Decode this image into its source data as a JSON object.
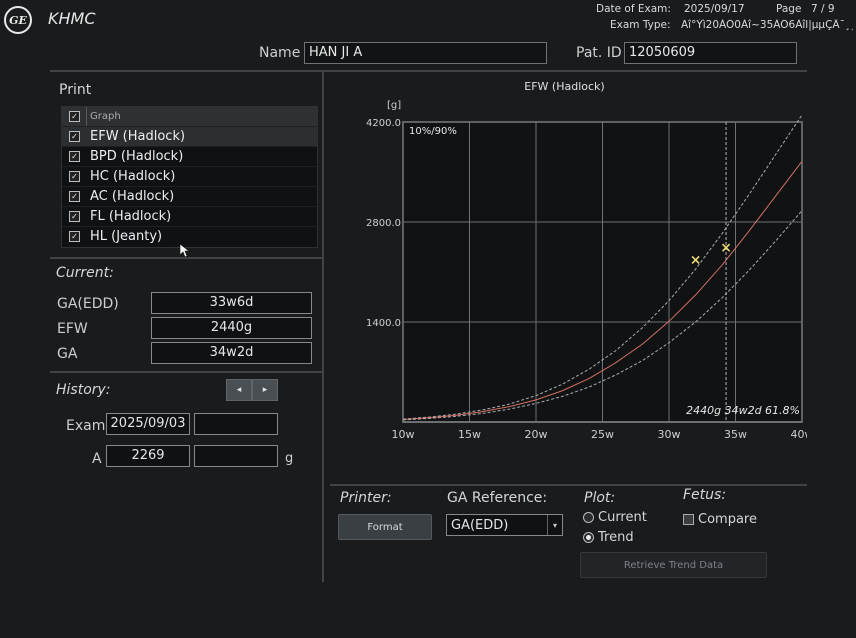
{
  "header": {
    "logo_text": "GE",
    "hospital": "KHMC",
    "date_label": "Date of Exam:",
    "date_value": "2025/09/17",
    "page_label": "Page",
    "page_value": "7 / 9",
    "exam_type_label": "Exam Type:",
    "exam_type_value": "Ãî°Ýì20ÀÖ0Àî~35ÀÖ6Àîl|µµÇÂ¯¸¸",
    "name_label": "Name",
    "name_value": "HAN JI A",
    "patid_label": "Pat. ID",
    "patid_value": "12050609"
  },
  "print": {
    "title": "Print",
    "column_header": "Graph",
    "header_checked": true,
    "items": [
      {
        "label": "EFW (Hadlock)",
        "checked": true,
        "selected": true
      },
      {
        "label": "BPD (Hadlock)",
        "checked": true,
        "selected": false
      },
      {
        "label": "HC (Hadlock)",
        "checked": true,
        "selected": false
      },
      {
        "label": "AC (Hadlock)",
        "checked": true,
        "selected": false
      },
      {
        "label": "FL (Hadlock)",
        "checked": true,
        "selected": false
      },
      {
        "label": "HL (Jeanty)",
        "checked": true,
        "selected": false
      }
    ]
  },
  "current": {
    "title": "Current:",
    "rows": [
      {
        "label": "GA(EDD)",
        "value": "33w6d"
      },
      {
        "label": "EFW",
        "value": "2440g"
      },
      {
        "label": "GA",
        "value": "34w2d"
      }
    ]
  },
  "history": {
    "title": "History:",
    "prev_icon": "chevron-left-icon",
    "next_icon": "chevron-right-icon",
    "exam_label": "Exam",
    "exam_value": "2025/09/03",
    "exam_value2": "",
    "a_label": "A",
    "a_value": "2269",
    "a_value2": "",
    "a_unit": "g"
  },
  "bottom": {
    "printer_label": "Printer:",
    "format_button": "Format",
    "ga_ref_label": "GA Reference:",
    "ga_ref_value": "GA(EDD)",
    "plot_label": "Plot:",
    "plot_options": [
      {
        "label": "Current",
        "selected": false
      },
      {
        "label": "Trend",
        "selected": true
      }
    ],
    "fetus_label": "Fetus:",
    "compare_label": "Compare",
    "compare_checked": false,
    "retrieve_button": "Retrieve Trend Data"
  },
  "chart_data": {
    "type": "line",
    "title": "EFW (Hadlock)",
    "ylabel": "[g]",
    "xlabel": "",
    "band_label": "10%/90%",
    "x_ticks": [
      "10w",
      "15w",
      "20w",
      "25w",
      "30w",
      "35w",
      "40w"
    ],
    "y_ticks": [
      "1400.0",
      "2800.0",
      "4200.0"
    ],
    "xlim": [
      10,
      40
    ],
    "ylim": [
      0,
      4200
    ],
    "grid": true,
    "x": [
      10,
      12,
      14,
      16,
      18,
      20,
      22,
      24,
      26,
      28,
      30,
      32,
      34,
      36,
      38,
      40
    ],
    "series": [
      {
        "role": "p90",
        "color": "#a9adb1",
        "dash": true,
        "values": [
          40,
          70,
          110,
          170,
          250,
          370,
          530,
          740,
          1000,
          1320,
          1700,
          2140,
          2640,
          3180,
          3740,
          4300
        ]
      },
      {
        "role": "median",
        "color": "#d47060",
        "dash": false,
        "values": [
          35,
          60,
          95,
          145,
          215,
          310,
          440,
          610,
          830,
          1090,
          1410,
          1780,
          2200,
          2670,
          3160,
          3650
        ]
      },
      {
        "role": "p10",
        "color": "#a9adb1",
        "dash": true,
        "values": [
          30,
          50,
          80,
          120,
          180,
          260,
          360,
          490,
          660,
          860,
          1110,
          1400,
          1740,
          2120,
          2530,
          2960
        ]
      }
    ],
    "points": [
      {
        "x": 32.0,
        "y": 2269,
        "color": "#f2dc78"
      },
      {
        "x": 34.29,
        "y": 2440,
        "color": "#f2dc78"
      }
    ],
    "current_ga_marker": 34.29,
    "annotation": "2440g 34w2d 61.8%"
  }
}
